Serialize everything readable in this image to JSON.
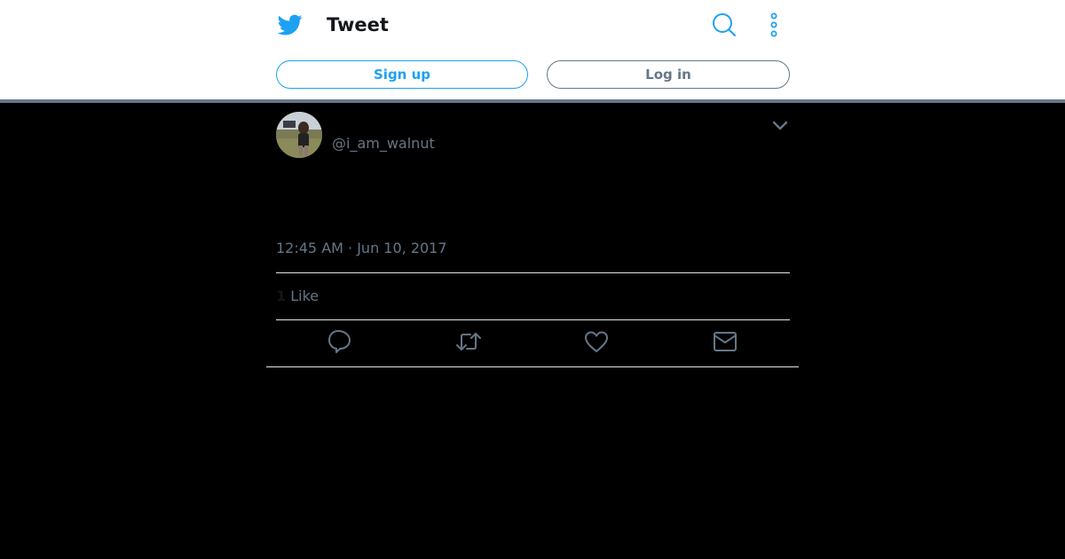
{
  "header": {
    "title": "Tweet",
    "logo_icon": "twitter-bird-icon",
    "search_icon": "search-icon",
    "more_icon": "more-vertical-icon",
    "brand_color": "#1da1f2"
  },
  "auth": {
    "signup_label": "Sign up",
    "login_label": "Log in"
  },
  "tweet": {
    "display_name": "",
    "username": "@i_am_walnut",
    "timestamp": "12:45 AM · Jun 10, 2017",
    "like_count": "1",
    "like_label": "Like",
    "caret_icon": "chevron-down-icon",
    "actions": [
      {
        "name": "reply",
        "icon": "reply-icon"
      },
      {
        "name": "retweet",
        "icon": "retweet-icon"
      },
      {
        "name": "like",
        "icon": "heart-icon"
      },
      {
        "name": "dm",
        "icon": "envelope-icon"
      }
    ]
  }
}
